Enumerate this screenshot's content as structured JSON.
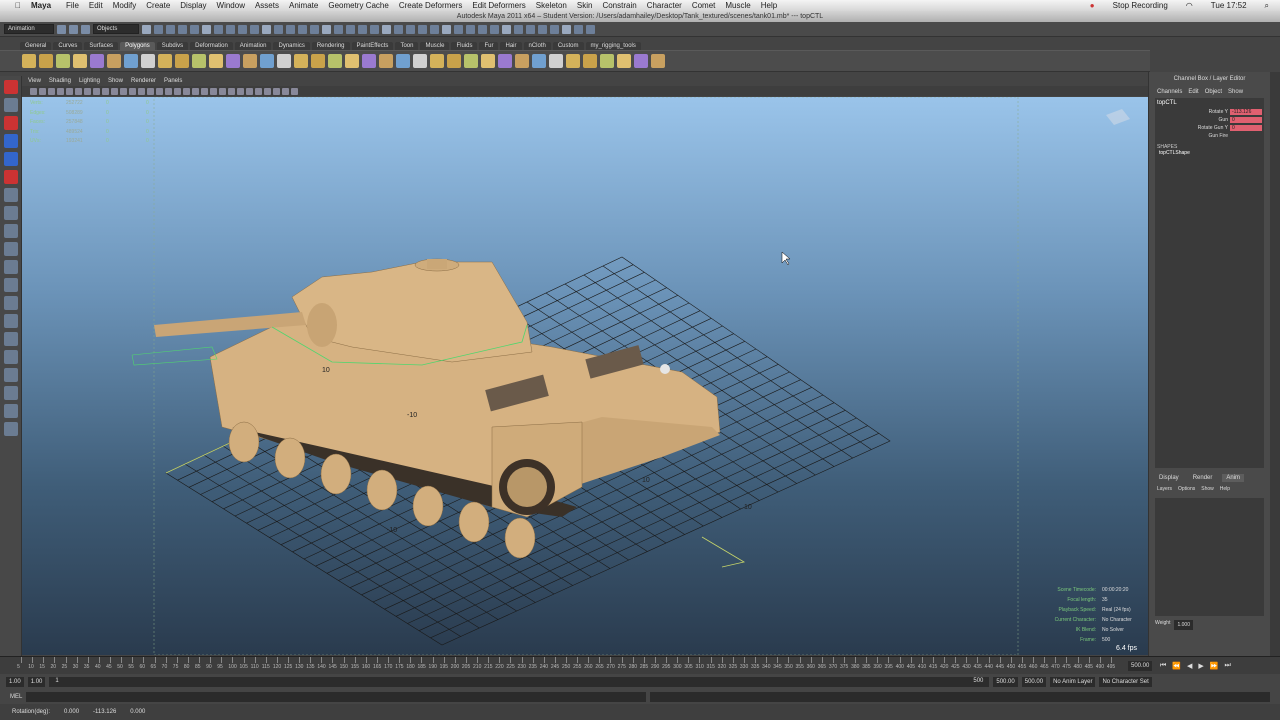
{
  "macbar": {
    "apple": "",
    "app": "Maya",
    "menus": [
      "File",
      "Edit",
      "Modify",
      "Create",
      "Display",
      "Window",
      "Assets",
      "Animate",
      "Geometry Cache",
      "Create Deformers",
      "Edit Deformers",
      "Skeleton",
      "Skin",
      "Constrain",
      "Character",
      "Comet",
      "Muscle",
      "Help"
    ],
    "stop": "Stop Recording",
    "clock": "Tue 17:52"
  },
  "window_title": "Autodesk Maya 2011 x64 – Student Version: /Users/adamhailey/Desktop/Tank_textured/scenes/tank01.mb* --- topCTL",
  "status": {
    "mode": "Animation",
    "selmode": "Objects"
  },
  "shelf_tabs": [
    "General",
    "Curves",
    "Surfaces",
    "Polygons",
    "Subdivs",
    "Deformation",
    "Animation",
    "Dynamics",
    "Rendering",
    "PaintEffects",
    "Toon",
    "Muscle",
    "Fluids",
    "Fur",
    "Hair",
    "nCloth",
    "Custom",
    "my_rigging_tools"
  ],
  "shelf_active": "Polygons",
  "panel_menu": [
    "View",
    "Shading",
    "Lighting",
    "Show",
    "Renderer",
    "Panels"
  ],
  "hud": {
    "rows": [
      {
        "k": "Verts:",
        "v": "252722",
        "a": "0",
        "b": "0"
      },
      {
        "k": "Edges:",
        "v": "508289",
        "a": "0",
        "b": "0"
      },
      {
        "k": "Faces:",
        "v": "257848",
        "a": "0",
        "b": "0"
      },
      {
        "k": "Tris:",
        "v": "489524",
        "a": "0",
        "b": "0"
      },
      {
        "k": "UVs:",
        "v": "193241",
        "a": "0",
        "b": "0"
      }
    ]
  },
  "hud_br": {
    "rows": [
      {
        "k": "Scene Timecode:",
        "v": "00:00:20:20"
      },
      {
        "k": "Focal length:",
        "v": "35"
      },
      {
        "k": "Playback Speed:",
        "v": "Real (24 fps)"
      },
      {
        "k": "Current Character:",
        "v": "No Character"
      },
      {
        "k": "IK Blend:",
        "v": "No Solver"
      },
      {
        "k": "Frame:",
        "v": "500"
      }
    ]
  },
  "fps": "6.4 fps",
  "grid_labels": [
    "-10",
    "10",
    "-10",
    "10",
    "10"
  ],
  "channelbox": {
    "title": "Channel Box / Layer Editor",
    "menus": [
      "Channels",
      "Edit",
      "Object",
      "Show"
    ],
    "object": "topCTL",
    "channels": [
      {
        "k": "Rotate Y",
        "v": "-113.126"
      },
      {
        "k": "Gun",
        "v": "0"
      },
      {
        "k": "Rotate Gun Y",
        "v": "0"
      },
      {
        "k": "Gun Fire",
        "v": ""
      }
    ],
    "shapes_label": "SHAPES",
    "shape": "topCTLShape"
  },
  "layers": {
    "tabs": [
      "Display",
      "Render",
      "Anim"
    ],
    "active": "Anim",
    "menus": [
      "Layers",
      "Options",
      "Show",
      "Help"
    ],
    "weight_label": "Weight",
    "weight": "1.000"
  },
  "timeline": {
    "ticks": [
      "5",
      "10",
      "15",
      "20",
      "25",
      "30",
      "35",
      "40",
      "45",
      "50",
      "55",
      "60",
      "65",
      "70",
      "75",
      "80",
      "85",
      "90",
      "95",
      "100",
      "105",
      "110",
      "115",
      "120",
      "125",
      "130",
      "135",
      "140",
      "145",
      "150",
      "155",
      "160",
      "165",
      "170",
      "175",
      "180",
      "185",
      "190",
      "195",
      "200",
      "205",
      "210",
      "215",
      "220",
      "225",
      "230",
      "235",
      "240",
      "245",
      "250",
      "255",
      "260",
      "265",
      "270",
      "275",
      "280",
      "285",
      "290",
      "295",
      "300",
      "305",
      "310",
      "315",
      "320",
      "325",
      "330",
      "335",
      "340",
      "345",
      "350",
      "355",
      "360",
      "365",
      "370",
      "375",
      "380",
      "385",
      "390",
      "395",
      "400",
      "405",
      "410",
      "415",
      "420",
      "425",
      "430",
      "435",
      "440",
      "445",
      "450",
      "455",
      "460",
      "465",
      "470",
      "475",
      "480",
      "485",
      "490",
      "495"
    ],
    "current": "500.00"
  },
  "range": {
    "start": "1.00",
    "inner_start": "1.00",
    "frame": "1",
    "end_frame": "500",
    "inner_end": "500.00",
    "end": "500.00",
    "anim_layer": "No Anim Layer",
    "char_set": "No Character Set"
  },
  "cmd": {
    "lang": "MEL"
  },
  "help": {
    "label": "Rotation(deg):",
    "x": "0.000",
    "y": "-113.126",
    "z": "0.000"
  }
}
